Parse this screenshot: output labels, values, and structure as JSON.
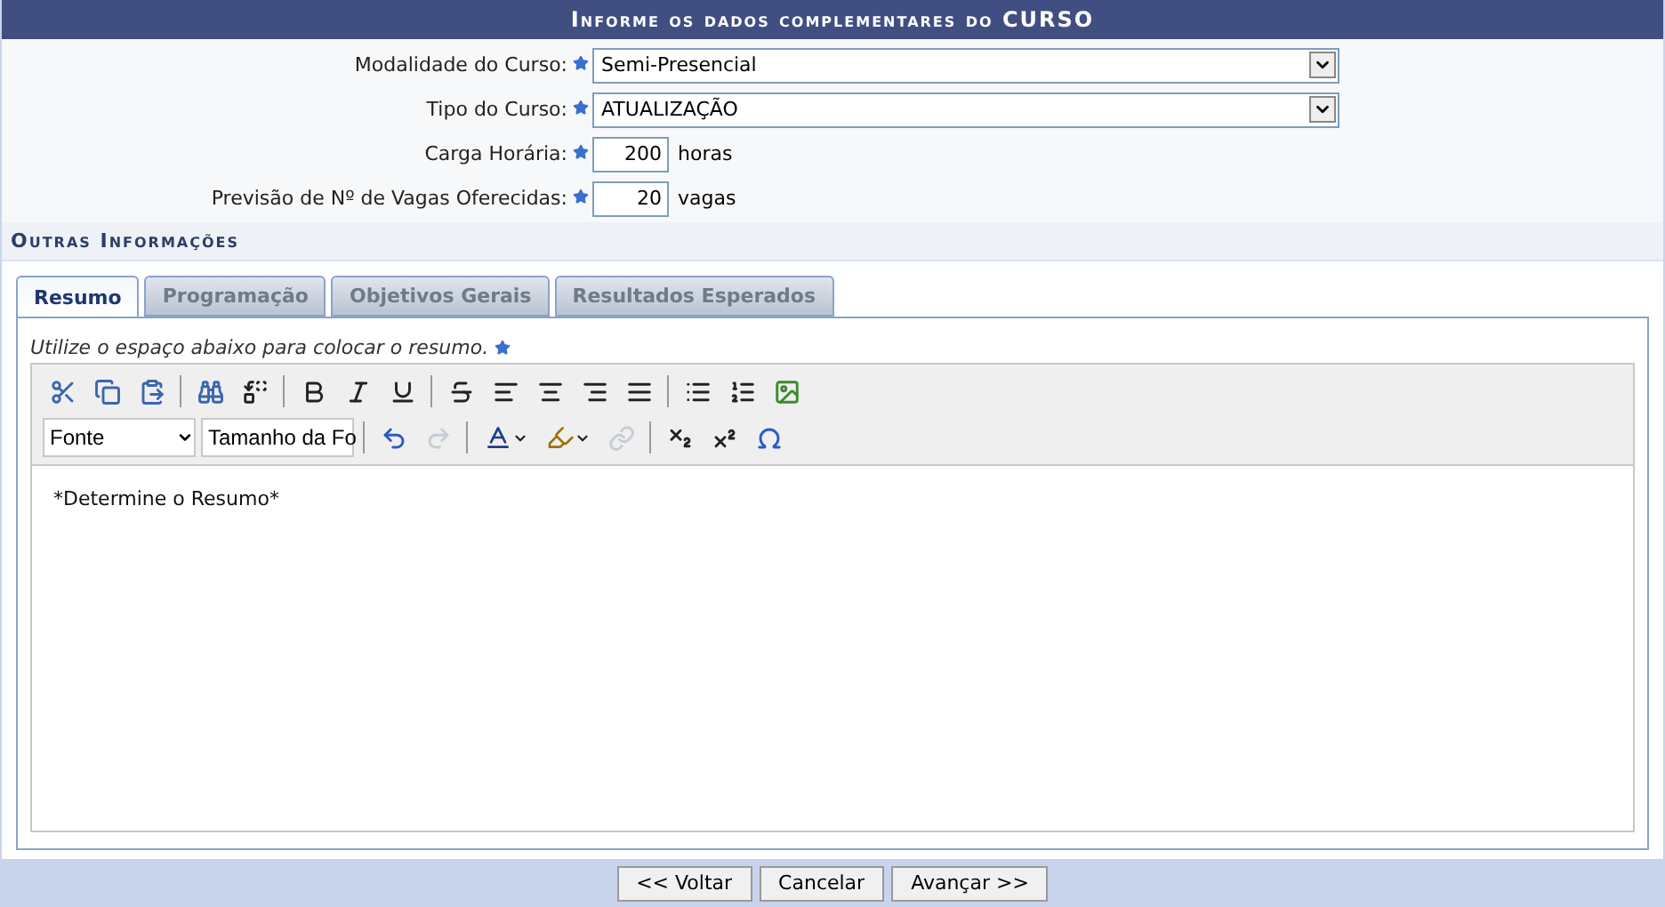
{
  "title": "Informe os dados complementares do CURSO",
  "fields": [
    {
      "kind": "select",
      "label": "Modalidade do Curso:",
      "required": true,
      "value": "Semi-Presencial"
    },
    {
      "kind": "select",
      "label": "Tipo do Curso:",
      "required": true,
      "value": "ATUALIZAÇÃO"
    },
    {
      "kind": "number",
      "label": "Carga Horária:",
      "required": true,
      "value": "200",
      "unit": "horas"
    },
    {
      "kind": "number",
      "label": "Previsão de Nº de Vagas Oferecidas:",
      "required": true,
      "value": "20",
      "unit": "vagas"
    }
  ],
  "section_title": "Outras Informações",
  "tabs": [
    {
      "label": "Resumo",
      "selected": true
    },
    {
      "label": "Programação",
      "selected": false
    },
    {
      "label": "Objetivos Gerais",
      "selected": false
    },
    {
      "label": "Resultados Esperados",
      "selected": false
    }
  ],
  "editor": {
    "hint": "Utilize o espaço abaixo para colocar o resumo.",
    "required": true,
    "toolbar_rows": [
      [
        {
          "kind": "button",
          "disabled": false
        },
        {
          "kind": "button",
          "disabled": false
        },
        {
          "kind": "button",
          "disabled": false
        },
        {
          "kind": "separator"
        },
        {
          "kind": "button",
          "disabled": false
        },
        {
          "kind": "button",
          "disabled": false
        },
        {
          "kind": "separator"
        },
        {
          "kind": "button",
          "disabled": false
        },
        {
          "kind": "button",
          "disabled": false
        },
        {
          "kind": "button",
          "disabled": false
        },
        {
          "kind": "separator"
        },
        {
          "kind": "button",
          "disabled": false
        },
        {
          "kind": "button",
          "disabled": false
        },
        {
          "kind": "button",
          "disabled": false
        },
        {
          "kind": "button",
          "disabled": false
        },
        {
          "kind": "button",
          "disabled": false
        },
        {
          "kind": "separator"
        },
        {
          "kind": "button",
          "disabled": false
        },
        {
          "kind": "button",
          "disabled": false
        },
        {
          "kind": "button",
          "disabled": false
        }
      ],
      [
        {
          "kind": "dropdown",
          "label": "Fonte"
        },
        {
          "kind": "dropdown",
          "label": "Tamanho da Fo"
        },
        {
          "kind": "separator"
        },
        {
          "kind": "button",
          "disabled": false
        },
        {
          "kind": "button",
          "disabled": true
        },
        {
          "kind": "separator"
        },
        {
          "kind": "color",
          "disabled": false
        },
        {
          "kind": "color",
          "disabled": false
        },
        {
          "kind": "button",
          "disabled": true
        },
        {
          "kind": "separator"
        },
        {
          "kind": "button",
          "disabled": false
        },
        {
          "kind": "button",
          "disabled": false
        },
        {
          "kind": "button",
          "disabled": false
        }
      ]
    ],
    "content": "*Determine o Resumo*"
  },
  "buttons": [
    "<< Voltar",
    "Cancelar",
    "Avançar >>"
  ]
}
